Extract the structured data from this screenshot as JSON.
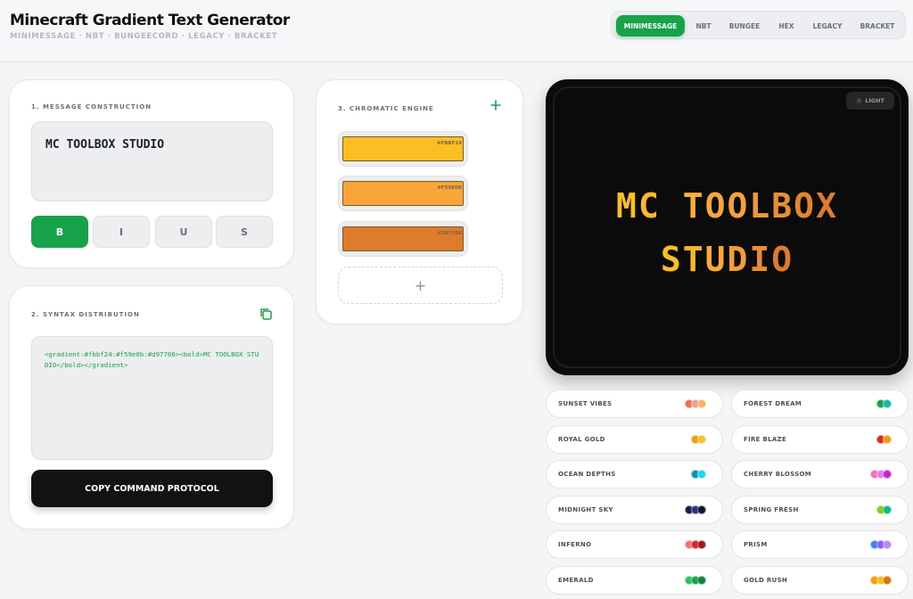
{
  "header": {
    "title": "Minecraft Gradient Text Generator",
    "subtitle": "MINIMESSAGE · NBT · BUNGEECORD · LEGACY · BRACKET",
    "tabs": [
      {
        "label": "MINIMESSAGE",
        "active": true
      },
      {
        "label": "NBT",
        "active": false
      },
      {
        "label": "BUNGEE",
        "active": false
      },
      {
        "label": "HEX",
        "active": false
      },
      {
        "label": "LEGACY",
        "active": false
      },
      {
        "label": "BRACKET",
        "active": false
      }
    ]
  },
  "message": {
    "label": "1. MESSAGE CONSTRUCTION",
    "text": "MC TOOLBOX STUDIO",
    "format_buttons": [
      {
        "label": "B",
        "active": true
      },
      {
        "label": "I",
        "active": false
      },
      {
        "label": "U",
        "active": false
      },
      {
        "label": "S",
        "active": false
      }
    ]
  },
  "syntax": {
    "label": "2. SYNTAX DISTRIBUTION",
    "code": "<gradient:#fbbf24:#f59e0b:#d97706><bold>MC TOOLBOX STUDIO</bold></gradient>",
    "copy_label": "COPY COMMAND PROTOCOL"
  },
  "chromatic": {
    "label": "3. CHROMATIC ENGINE",
    "colors": [
      {
        "hex": "#FBBF24",
        "color": "#fbbf24"
      },
      {
        "hex": "#F59E0B",
        "color": "#f9a53a"
      },
      {
        "hex": "#D97706",
        "color": "#de7b2c"
      }
    ],
    "add_label": "+"
  },
  "preview": {
    "theme_label": "LIGHT",
    "line1": "MC TOOLBOX",
    "line2": "STUDIO"
  },
  "presets": [
    {
      "name": "SUNSET VIBES",
      "colors": [
        "#ef6b5b",
        "#f59e8b",
        "#f7b267"
      ]
    },
    {
      "name": "FOREST DREAM",
      "colors": [
        "#16a34a",
        "#14b8a6"
      ]
    },
    {
      "name": "ROYAL GOLD",
      "colors": [
        "#f59e0b",
        "#fbbf24"
      ]
    },
    {
      "name": "FIRE BLAZE",
      "colors": [
        "#dc2626",
        "#f59e0b"
      ]
    },
    {
      "name": "OCEAN DEPTHS",
      "colors": [
        "#0891b2",
        "#22d3ee"
      ]
    },
    {
      "name": "CHERRY BLOSSOM",
      "colors": [
        "#f472b6",
        "#e879f9",
        "#c026d3"
      ]
    },
    {
      "name": "MIDNIGHT SKY",
      "colors": [
        "#1e1b4b",
        "#312e81",
        "#111827"
      ]
    },
    {
      "name": "SPRING FRESH",
      "colors": [
        "#84cc16",
        "#10b981"
      ]
    },
    {
      "name": "INFERNO",
      "colors": [
        "#f87171",
        "#dc2626",
        "#991b1b"
      ]
    },
    {
      "name": "PRISM",
      "colors": [
        "#3b82f6",
        "#8b5cf6",
        "#c084fc"
      ]
    },
    {
      "name": "EMERALD",
      "colors": [
        "#22c55e",
        "#16a34a",
        "#15803d"
      ]
    },
    {
      "name": "GOLD RUSH",
      "colors": [
        "#f59e0b",
        "#fbbf24",
        "#d97706"
      ]
    }
  ]
}
